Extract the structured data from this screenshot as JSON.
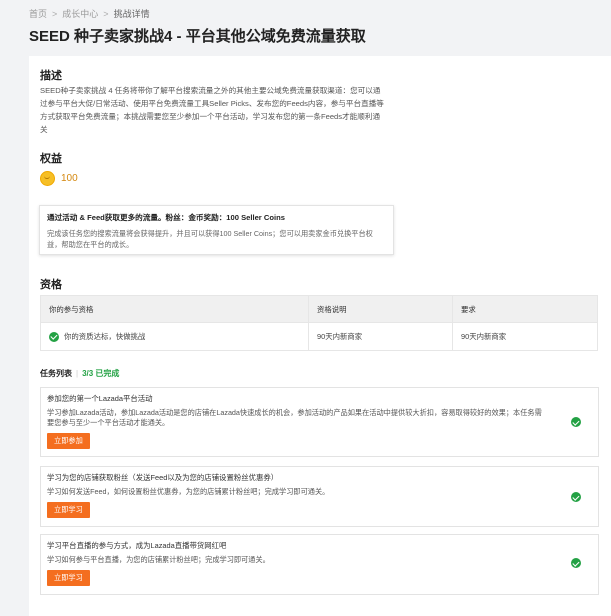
{
  "breadcrumb": {
    "home": "首页",
    "growth": "成长中心",
    "current": "挑战详情"
  },
  "page_title": "SEED 种子卖家挑战4 - 平台其他公域免费流量获取",
  "description": {
    "title": "描述",
    "text": "SEED种子卖家挑战 4 任务将带你了解平台搜索流量之外的其他主要公域免费流量获取渠道：您可以通过参与平台大促/日常活动、使用平台免费流量工具Seller Picks、发布您的Feeds内容，参与平台直播等方式获取平台免费流量；本挑战需要您至少参加一个平台活动，学习发布您的第一条Feeds才能顺利通关"
  },
  "benefits": {
    "title": "权益",
    "coins": "100",
    "box_title": "通过活动 & Feed获取更多的流量。粉丝：金币奖励：100 Seller Coins",
    "box_text": "完成该任务您的搜索流量将会获得提升，并且可以获得100 Seller Coins；您可以用卖家金币兑换平台权益，帮助您在平台的成长。"
  },
  "qualification": {
    "title": "资格",
    "headers": [
      "你的参与资格",
      "资格说明",
      "要求"
    ],
    "row": {
      "status": "你的资质达标，快做挑战",
      "desc": "90天内新商家",
      "req": "90天内新商家"
    }
  },
  "tasks": {
    "title": "任务列表",
    "progress": "3/3 已完成",
    "items": [
      {
        "title": "参加您的第一个Lazada平台活动",
        "desc": "学习参加Lazada活动，参加Lazada活动是您的店铺在Lazada快速成长的机会，参加活动的产品如果在活动中提供较大折扣，容易取得较好的效果；本任务需要您参与至少一个平台活动才能通关。",
        "button": "立即参加"
      },
      {
        "title": "学习为您的店铺获取粉丝（发送Feed以及为您的店铺设置粉丝优惠券）",
        "desc": "学习如何发送Feed，如何设置粉丝优惠券，为您的店铺累计粉丝吧；完成学习即可通关。",
        "button": "立即学习"
      },
      {
        "title": "学习平台直播的参与方式，成为Lazada直播带货网红吧",
        "desc": "学习如何参与平台直播，为您的店铺累计粉丝吧；完成学习即可通关。",
        "button": "立即学习"
      }
    ]
  },
  "colors": {
    "accent": "#f46e1f",
    "success": "#23a144",
    "coin": "#f6bf26"
  }
}
